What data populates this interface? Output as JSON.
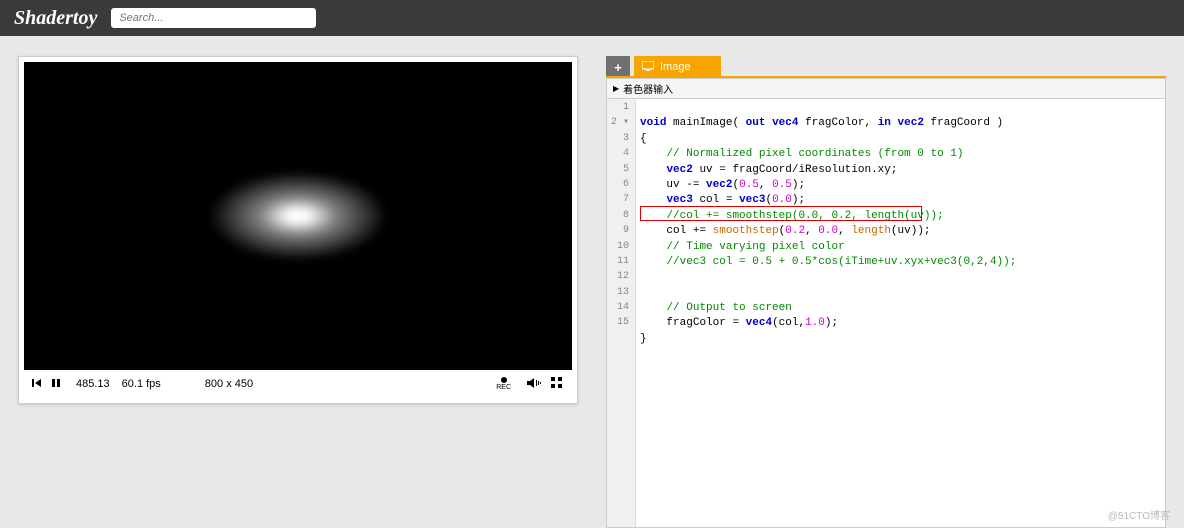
{
  "header": {
    "logo": "Shadertoy",
    "search_placeholder": "Search..."
  },
  "player": {
    "time": "485.13",
    "fps": "60.1 fps",
    "resolution": "800 x 450",
    "rec_label": "REC"
  },
  "tabs": {
    "add": "+",
    "image": "Image"
  },
  "input_bar": {
    "label": "着色器输入"
  },
  "code": {
    "lines": [
      {
        "n": "1",
        "html": "<span class='kw'>void</span> mainImage( <span class='kw'>out</span> <span class='kw'>vec4</span> fragColor, <span class='kw'>in</span> <span class='kw'>vec2</span> fragCoord )"
      },
      {
        "n": "2",
        "html": "{"
      },
      {
        "n": "3",
        "html": "    <span class='cm'>// Normalized pixel coordinates (from 0 to 1)</span>"
      },
      {
        "n": "4",
        "html": "    <span class='kw'>vec2</span> uv = fragCoord/iResolution.xy;"
      },
      {
        "n": "5",
        "html": "    uv -= <span class='kw'>vec2</span>(<span class='num'>0.5</span>, <span class='num'>0.5</span>);"
      },
      {
        "n": "6",
        "html": "    <span class='kw'>vec3</span> col = <span class='kw'>vec3</span>(<span class='num'>0.0</span>);"
      },
      {
        "n": "7",
        "html": "    <span class='cm'>//col += smoothstep(0.0, 0.2, length(uv));</span>"
      },
      {
        "n": "8",
        "html": "    col += <span class='builtin'>smoothstep</span>(<span class='num'>0.2</span>, <span class='num'>0.0</span>, <span class='builtin'>length</span>(uv));"
      },
      {
        "n": "9",
        "html": "    <span class='cm'>// Time varying pixel color</span>"
      },
      {
        "n": "10",
        "html": "    <span class='cm'>//vec3 col = 0.5 + 0.5*cos(iTime+uv.xyx+vec3(0,2,4));</span>"
      },
      {
        "n": "11",
        "html": ""
      },
      {
        "n": "12",
        "html": ""
      },
      {
        "n": "13",
        "html": "    <span class='cm'>// Output to screen</span>"
      },
      {
        "n": "14",
        "html": "    fragColor = <span class='kw'>vec4</span>(col,<span class='num'>1.0</span>);"
      },
      {
        "n": "15",
        "html": "}"
      }
    ]
  },
  "watermark": "@51CTO博客"
}
